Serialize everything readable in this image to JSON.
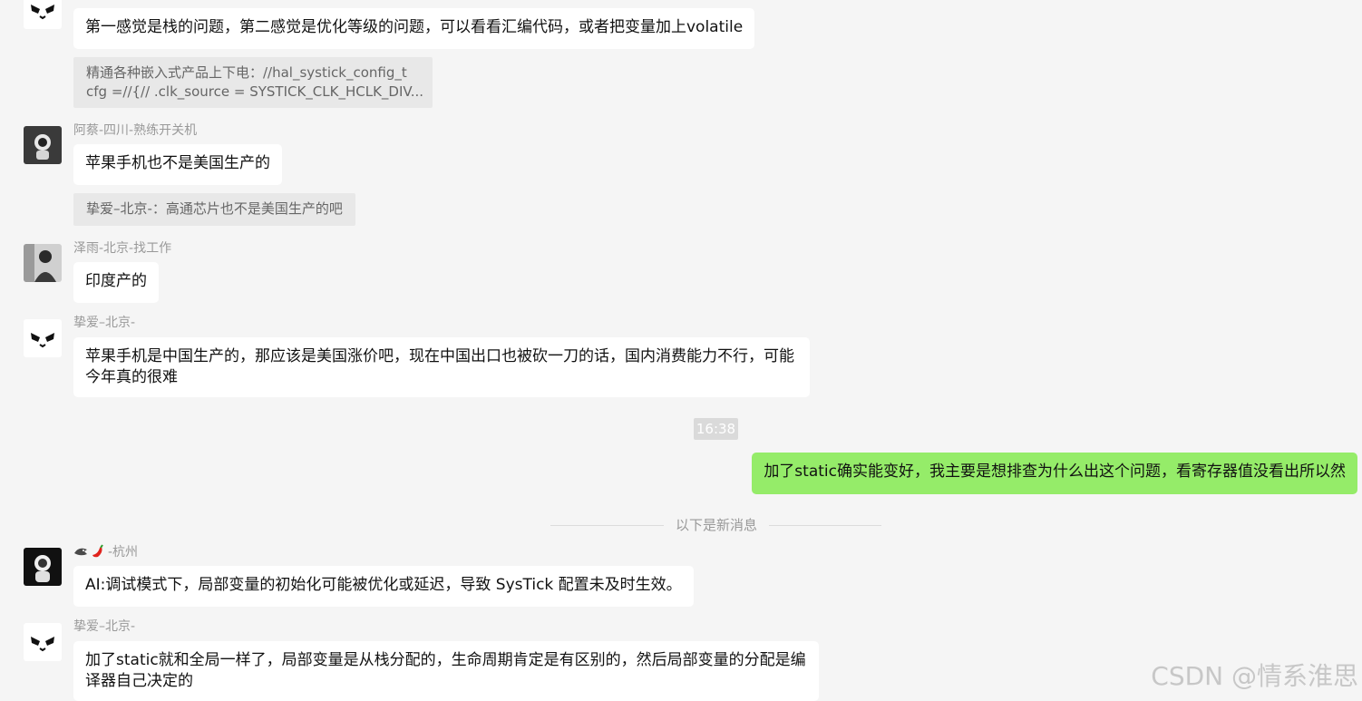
{
  "messages": {
    "m1": {
      "text": "第一感觉是栈的问题，第二感觉是优化等级的问题，可以看看汇编代码，或者把变量加上volatile"
    },
    "q1": {
      "line1": "精通各种嵌入式产品上下电：//hal_systick_config_t",
      "line2": "cfg =//{//    .clk_source = SYSTICK_CLK_HCLK_DIV..."
    },
    "m2": {
      "sender": "阿蔡-四川-熟练开关机",
      "text": "苹果手机也不是美国生产的"
    },
    "q2": {
      "text": "挚爱–北京-：高通芯片也不是美国生产的吧"
    },
    "m3": {
      "sender": "泽雨-北京-找工作",
      "text": "印度产的"
    },
    "m4": {
      "sender": "挚爱–北京-",
      "text": "苹果手机是中国生产的，那应该是美国涨价吧，现在中国出口也被砍一刀的话，国内消费能力不行，可能今年真的很难"
    },
    "time": "16:38",
    "m5": {
      "text": "加了static确实能变好，我主要是想排查为什么出这个问题，看寄存器值没看出所以然"
    },
    "new_divider": "以下是新消息",
    "m6": {
      "sender_suffix": "-杭州",
      "emoji_names": [
        "shark-icon",
        "chili-icon"
      ],
      "text": "AI:调试模式下，局部变量的初始化可能被优化或延迟，导致 SysTick 配置未及时生效。"
    },
    "m7": {
      "sender": "挚爱–北京-",
      "text": "加了static就和全局一样了，局部变量是从栈分配的，生命周期肯定是有区别的，然后局部变量的分配是编译器自己决定的"
    }
  },
  "watermark": "CSDN @情系淮思",
  "colors": {
    "background": "#f5f5f5",
    "bubble_other": "#ffffff",
    "bubble_self": "#95ec69",
    "quote_bg": "#e8e8e8"
  }
}
